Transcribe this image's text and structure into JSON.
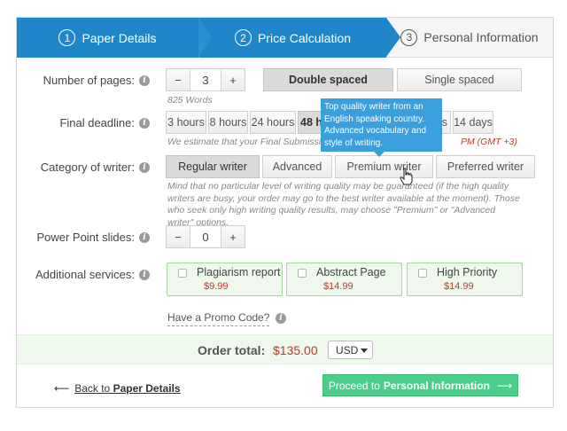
{
  "steps": [
    {
      "num": "1",
      "label": "Paper Details"
    },
    {
      "num": "2",
      "label": "Price Calculation"
    },
    {
      "num": "3",
      "label": "Personal Information"
    }
  ],
  "pages": {
    "label": "Number of pages:",
    "minus": "−",
    "value": "3",
    "plus": "+",
    "words": "825 Words",
    "spacing": [
      "Double spaced",
      "Single spaced"
    ],
    "selected_spacing": "Double spaced"
  },
  "deadline": {
    "label": "Final deadline:",
    "options": [
      "3 hours",
      "8 hours",
      "24 hours",
      "48 ho",
      "s",
      "14 days"
    ],
    "note_start": "We estimate that your Final Submission De",
    "note_end": "PM (GMT +3)"
  },
  "writer": {
    "label": "Category of writer:",
    "options": [
      "Regular writer",
      "Advanced",
      "Premium writer",
      "Preferred writer"
    ],
    "selected": "Regular writer",
    "tooltip": "Top quality writer from an English speaking country. Advanced vocabulary and style of writing.",
    "note": "Mind that no particular level of writing quality may be guaranteed (if the high quality writers are busy, your order may go to the best writer available at the moment). Those who seek only high writing quality results, may choose \"Premium\" or \"Advanced writer\" options."
  },
  "slides": {
    "label": "Power Point slides:",
    "minus": "−",
    "value": "0",
    "plus": "+"
  },
  "services": {
    "label": "Additional services:",
    "items": [
      {
        "name": "Plagiarism report",
        "price": "$9.99"
      },
      {
        "name": "Abstract Page",
        "price": "$14.99"
      },
      {
        "name": "High Priority",
        "price": "$14.99"
      }
    ]
  },
  "promo": {
    "label": "Have a Promo Code?"
  },
  "total": {
    "label": "Order total:",
    "value": "$135.00",
    "currency": "USD"
  },
  "footer": {
    "back_arrow": "⟵",
    "back_prefix": "Back to ",
    "back_target": "Paper Details",
    "proceed_prefix": "Proceed to",
    "proceed_target": "Personal Information",
    "proceed_arrow": "⟶"
  },
  "colors": {
    "accent": "#1f87c9",
    "price": "#c0392b",
    "proceed": "#4bce8a",
    "service_bg": "#eef8ec"
  }
}
